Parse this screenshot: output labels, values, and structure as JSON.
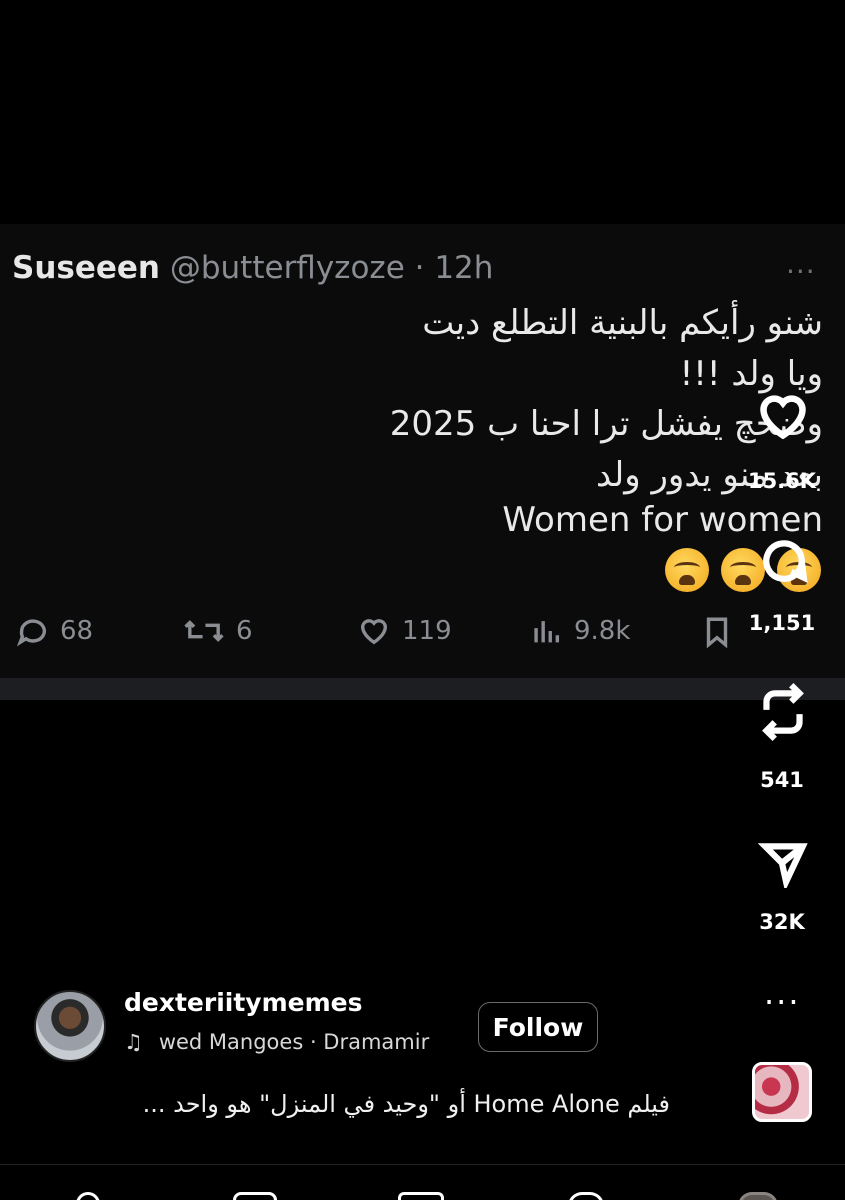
{
  "tweet": {
    "display_name": "Suseeen",
    "handle_time": "@butterflyzoze · 12h",
    "more": "···",
    "lines": [
      "شنو رأيكم بالبنية التطلع ديت",
      "ويا ولد !!!",
      "وضحچ يفشل ترا احنا ب 2025",
      "بعد منو يدور ولد",
      "Women for women"
    ],
    "emojis": [
      "loudly-crying-face",
      "loudly-crying-face",
      "loudly-crying-face"
    ],
    "stats": {
      "replies": "68",
      "reposts": "6",
      "likes": "119",
      "views": "9.8k"
    }
  },
  "rail": {
    "likes": "15.6K",
    "comments": "1,151",
    "reposts": "541",
    "shares": "32K",
    "more": "···"
  },
  "reel": {
    "username": "dexteriitymemes",
    "music": "wed Mangoes · Dramamir",
    "follow_label": "Follow",
    "caption": "فيلم Home Alone أو \"وحيد في المنزل\" هو واحد ..."
  }
}
